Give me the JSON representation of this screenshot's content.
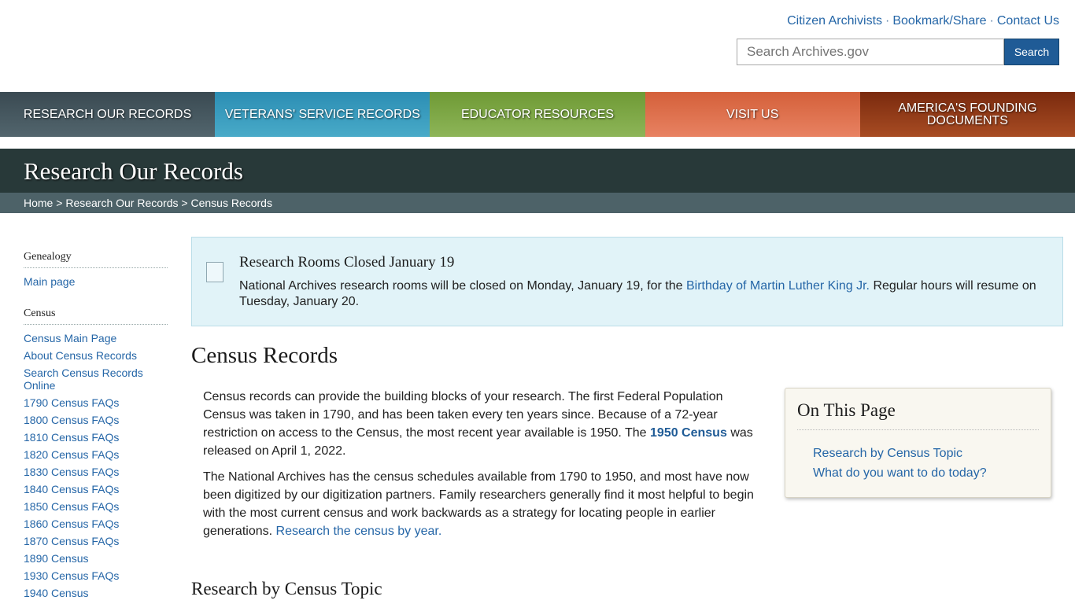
{
  "utility": {
    "links": [
      "Citizen Archivists",
      "Bookmark/Share",
      "Contact Us"
    ],
    "separator": "·"
  },
  "search": {
    "placeholder": "Search Archives.gov",
    "button_label": "Search"
  },
  "nav": [
    {
      "label": "RESEARCH OUR RECORDS",
      "color": "#3a4a52"
    },
    {
      "label": "VETERANS' SERVICE RECORDS",
      "color": "#2c8eb4"
    },
    {
      "label": "EDUCATOR RESOURCES",
      "color": "#6f9a35"
    },
    {
      "label": "VISIT US",
      "color": "#d4603a"
    },
    {
      "label": "AMERICA'S FOUNDING DOCUMENTS",
      "color": "#7a2a0e"
    }
  ],
  "banner": {
    "title": "Research Our Records"
  },
  "breadcrumb": {
    "items": [
      "Home",
      "Research Our Records",
      "Census Records"
    ],
    "separator": ">"
  },
  "sidebar": {
    "genealogy_heading": "Genealogy",
    "genealogy_links": [
      "Main page"
    ],
    "census_heading": "Census",
    "census_links": [
      "Census Main Page",
      "About Census Records",
      "Search Census Records Online",
      "1790 Census FAQs",
      "1800 Census FAQs",
      "1810 Census FAQs",
      "1820 Census FAQs",
      "1830 Census FAQs",
      "1840 Census FAQs",
      "1850 Census FAQs",
      "1860 Census FAQs",
      "1870 Census FAQs",
      "1890 Census",
      "1930 Census FAQs",
      "1940 Census"
    ]
  },
  "alert": {
    "title": "Research Rooms Closed January 19",
    "text_before": "National Archives research rooms will be closed on Monday, January 19, for the",
    "link": "Birthday of Martin Luther King Jr.",
    "text_after": "Regular hours will resume on Tuesday, January 20."
  },
  "main": {
    "title": "Census Records",
    "para1_before": "Census records can provide the building blocks of your research.  The first Federal Population Census was taken in 1790, and has been taken every ten years since.  Because of a 72-year restriction on access to the Census, the most recent year available is 1950. The",
    "para1_link": "1950 Census",
    "para1_after": "was released on April 1, 2022.",
    "para2_before": "The National Archives has the census schedules available from 1790 to 1950, and most have now been digitized by our digitization partners. Family researchers generally find it most helpful to begin with the most current census and work backwards as a strategy for locating people in earlier generations.",
    "para2_link": "Research the census by year.",
    "section_heading": "Research by Census Topic"
  },
  "on_this_page": {
    "title": "On This Page",
    "links": [
      "Research by Census Topic",
      "What do you want to do today?"
    ]
  }
}
